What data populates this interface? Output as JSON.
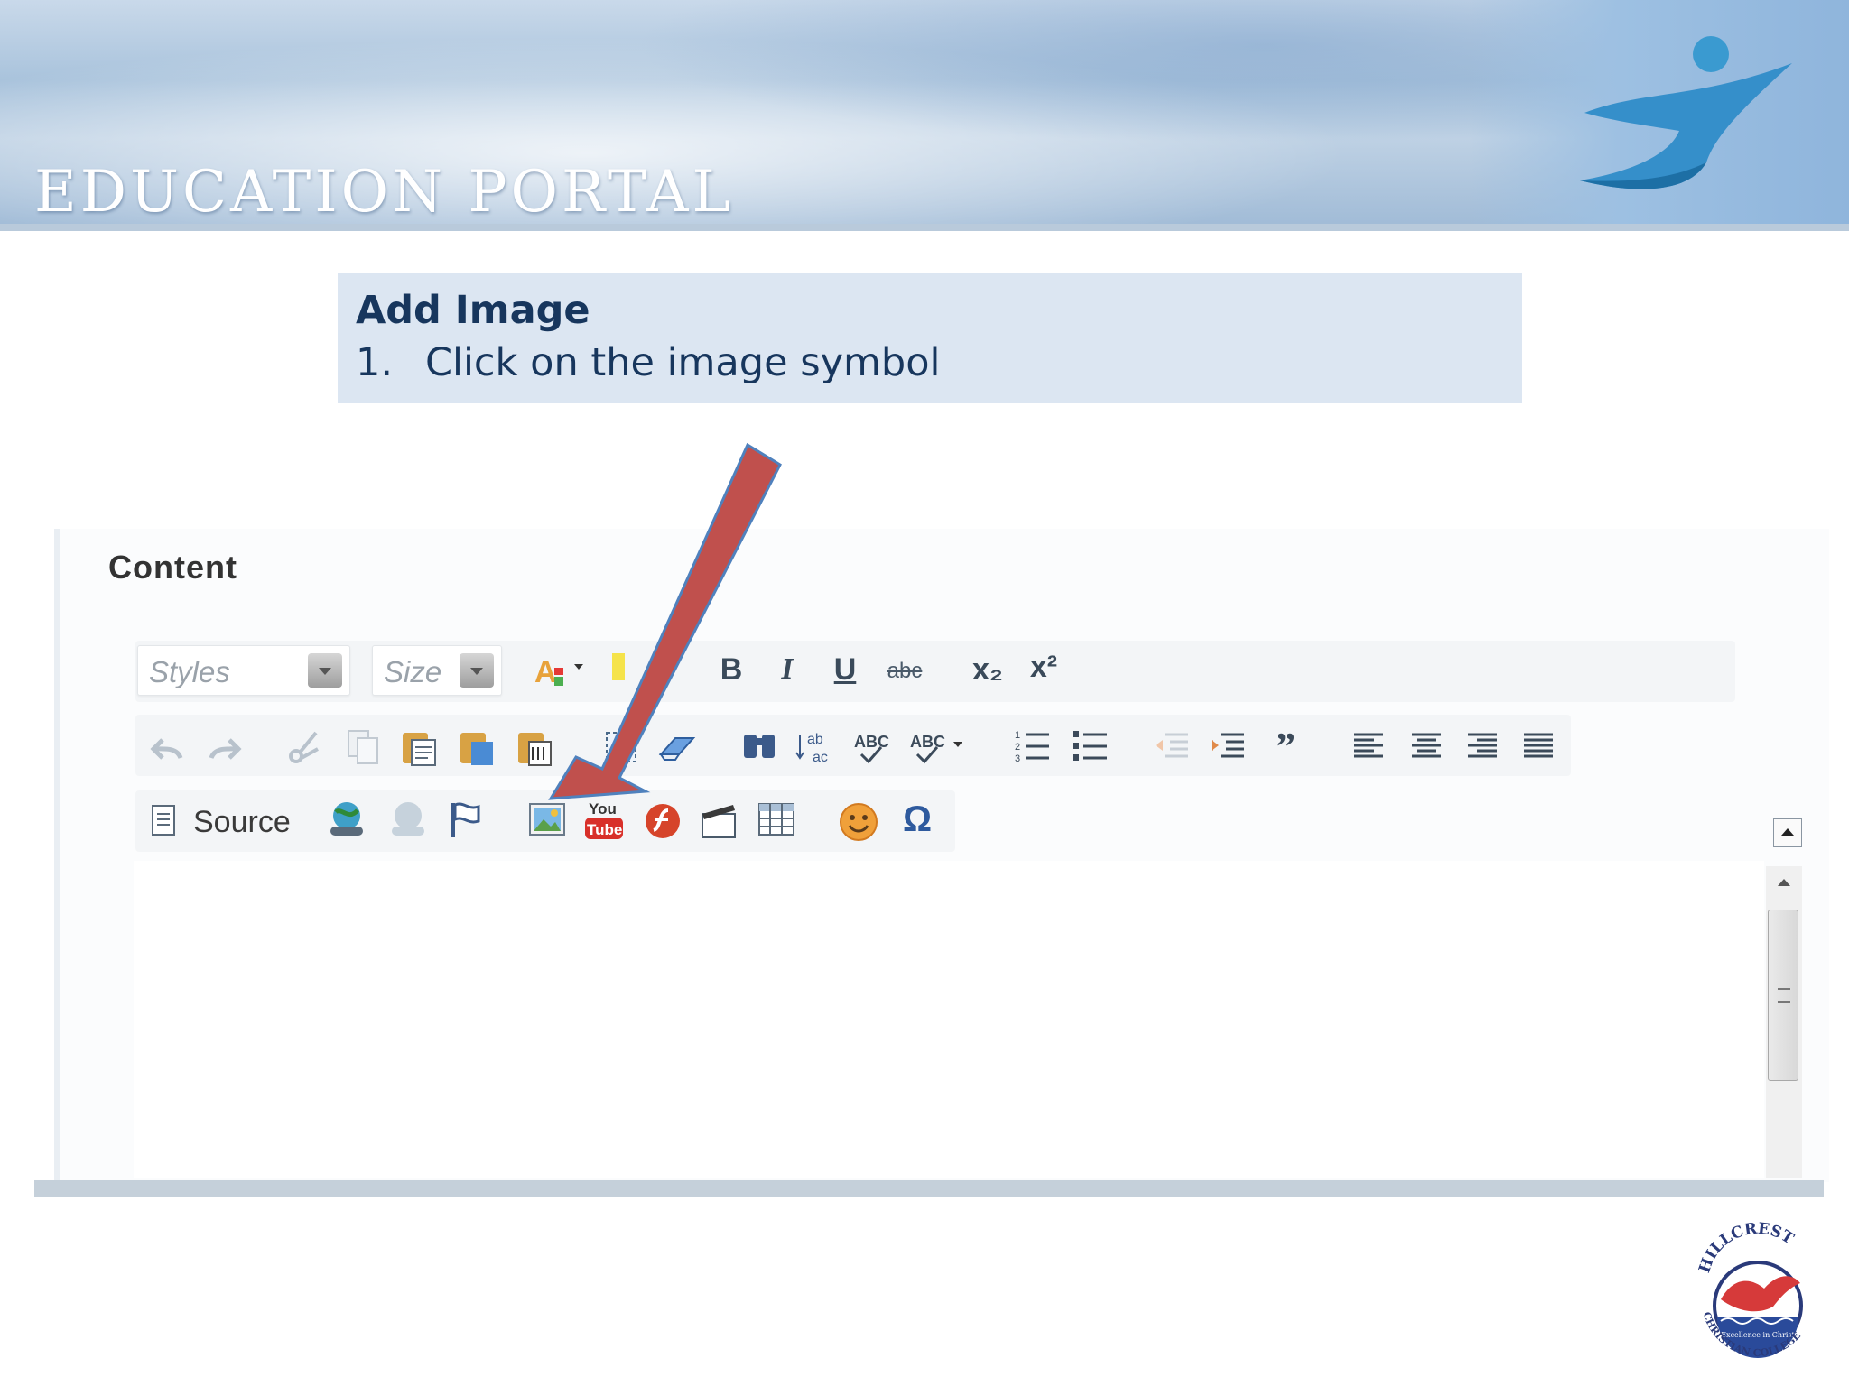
{
  "banner": {
    "title": "Education Portal"
  },
  "instruction": {
    "title": "Add Image",
    "step_number": "1.",
    "step_text": "Click on the image symbol"
  },
  "editor": {
    "section_label": "Content",
    "styles_placeholder": "Styles",
    "size_placeholder": "Size",
    "bold_glyph": "B",
    "italic_glyph": "I",
    "underline_glyph": "U",
    "strike_glyph": "abc",
    "source_label": "Source",
    "youtube_top": "You",
    "youtube_bottom": "Tube",
    "special_char_glyph": "Ω",
    "subscript_glyph": "x₂",
    "superscript_glyph": "x²"
  },
  "school_logo": {
    "top_text": "HILLCREST",
    "motto": "Excellence in Christ",
    "bottom_text": "CHRISTIAN COLLEGE"
  },
  "colors": {
    "instruction_bg": "#dce6f2",
    "instruction_text": "#17365d",
    "arrow_fill": "#c0504d",
    "arrow_stroke": "#4f81bd"
  }
}
